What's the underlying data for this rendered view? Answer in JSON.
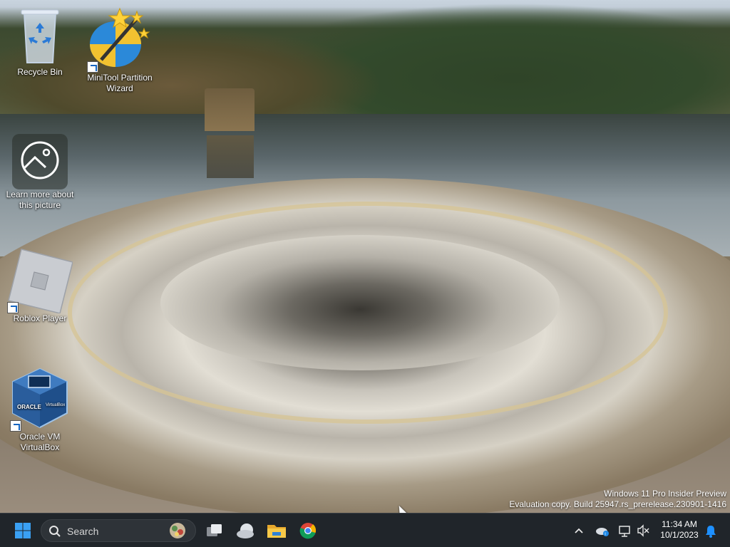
{
  "desktop": {
    "icons": [
      {
        "label": "Recycle Bin",
        "icon": "recycle-bin-icon"
      },
      {
        "label": "MiniTool Partition Wizard",
        "icon": "minitool-partition-wizard-icon",
        "shortcut": true
      },
      {
        "label": "Learn more about this picture",
        "icon": "camera-icon"
      },
      {
        "label": "Roblox Player",
        "icon": "roblox-icon",
        "shortcut": true
      },
      {
        "label": "Oracle VM VirtualBox",
        "icon": "virtualbox-icon",
        "shortcut": true
      }
    ],
    "watermark": {
      "line1": "Windows 11 Pro Insider Preview",
      "line2": "Evaluation copy. Build 25947.rs_prerelease.230901-1416"
    }
  },
  "taskbar": {
    "start_icon": "windows-start-icon",
    "search_placeholder": "Search",
    "pinned": [
      {
        "name": "task-view",
        "icon": "task-view-icon"
      },
      {
        "name": "widgets",
        "icon": "weather-cloud-icon"
      },
      {
        "name": "file-explorer",
        "icon": "folder-icon"
      },
      {
        "name": "chrome",
        "icon": "chrome-icon"
      }
    ],
    "tray": {
      "time": "11:34 AM",
      "date": "10/1/2023",
      "icons": [
        "chevron-up-icon",
        "onedrive-icon",
        "network-icon",
        "volume-muted-icon",
        "notification-bell-icon"
      ]
    }
  },
  "colors": {
    "taskbar_bg": "#20252a",
    "accent": "#0a84ff"
  }
}
